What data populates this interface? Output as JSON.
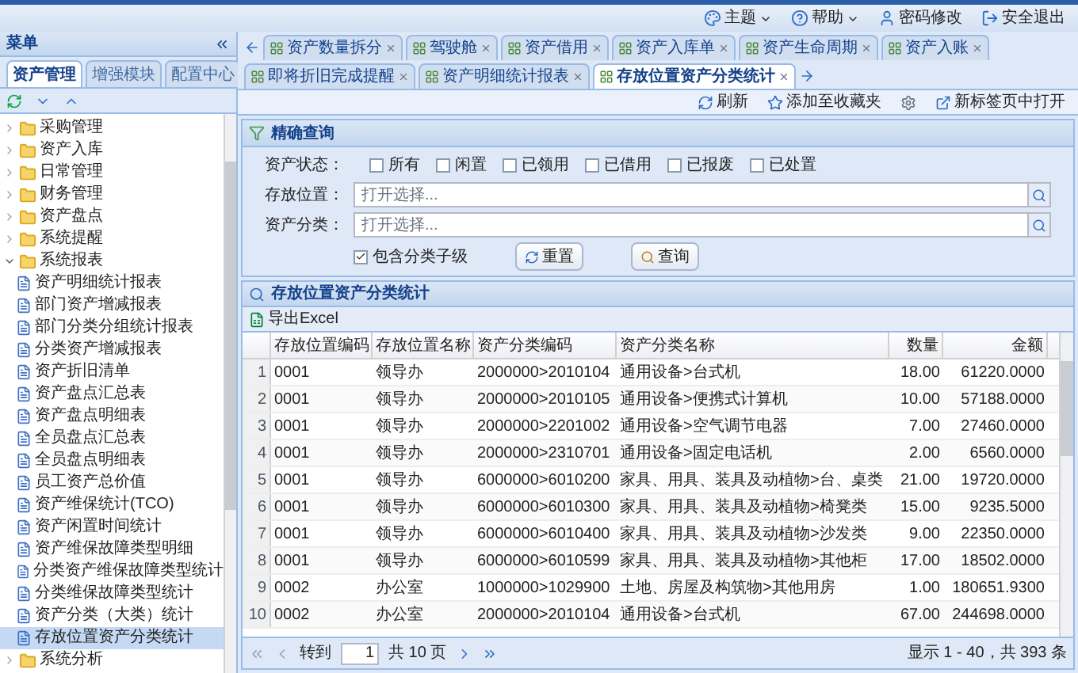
{
  "header": {
    "links": [
      {
        "label": "主题",
        "kind": "menu"
      },
      {
        "label": "帮助",
        "kind": "menu"
      },
      {
        "label": "密码修改",
        "kind": "link"
      },
      {
        "label": "安全退出",
        "kind": "link"
      }
    ]
  },
  "sidebar": {
    "title": "菜单",
    "tabs": [
      {
        "label": "资产管理",
        "selected": true
      },
      {
        "label": "增强模块",
        "selected": false
      },
      {
        "label": "配置中心",
        "selected": false
      }
    ],
    "tree": [
      {
        "label": "采购管理",
        "kind": "folder",
        "expanded": false,
        "selected": false
      },
      {
        "label": "资产入库",
        "kind": "folder",
        "expanded": false,
        "selected": false
      },
      {
        "label": "日常管理",
        "kind": "folder",
        "expanded": false,
        "selected": false
      },
      {
        "label": "财务管理",
        "kind": "folder",
        "expanded": false,
        "selected": false
      },
      {
        "label": "资产盘点",
        "kind": "folder",
        "expanded": false,
        "selected": false
      },
      {
        "label": "系统提醒",
        "kind": "folder",
        "expanded": false,
        "selected": false
      },
      {
        "label": "系统报表",
        "kind": "folder",
        "expanded": true,
        "selected": false,
        "children": [
          {
            "label": "资产明细统计报表",
            "kind": "report",
            "selected": false
          },
          {
            "label": "部门资产增减报表",
            "kind": "report",
            "selected": false
          },
          {
            "label": "部门分类分组统计报表",
            "kind": "report",
            "selected": false
          },
          {
            "label": "分类资产增减报表",
            "kind": "report",
            "selected": false
          },
          {
            "label": "资产折旧清单",
            "kind": "report",
            "selected": false
          },
          {
            "label": "资产盘点汇总表",
            "kind": "report",
            "selected": false
          },
          {
            "label": "资产盘点明细表",
            "kind": "report",
            "selected": false
          },
          {
            "label": "全员盘点汇总表",
            "kind": "report",
            "selected": false
          },
          {
            "label": "全员盘点明细表",
            "kind": "report",
            "selected": false
          },
          {
            "label": "员工资产总价值",
            "kind": "report",
            "selected": false
          },
          {
            "label": "资产维保统计(TCO)",
            "kind": "report",
            "selected": false
          },
          {
            "label": "资产闲置时间统计",
            "kind": "report",
            "selected": false
          },
          {
            "label": "资产维保故障类型明细",
            "kind": "report",
            "selected": false
          },
          {
            "label": "分类资产维保故障类型统计",
            "kind": "report",
            "selected": false
          },
          {
            "label": "分类维保故障类型统计",
            "kind": "report",
            "selected": false
          },
          {
            "label": "资产分类（大类）统计",
            "kind": "report",
            "selected": false
          },
          {
            "label": "存放位置资产分类统计",
            "kind": "report",
            "selected": true
          }
        ]
      },
      {
        "label": "系统分析",
        "kind": "folder",
        "expanded": false,
        "selected": false
      }
    ]
  },
  "tabs": [
    {
      "label": "资产数量拆分",
      "selected": false
    },
    {
      "label": "驾驶舱",
      "selected": false
    },
    {
      "label": "资产借用",
      "selected": false
    },
    {
      "label": "资产入库单",
      "selected": false
    },
    {
      "label": "资产生命周期",
      "selected": false
    },
    {
      "label": "资产入账",
      "selected": false
    },
    {
      "label": "即将折旧完成提醒",
      "selected": false
    },
    {
      "label": "资产明细统计报表",
      "selected": false
    },
    {
      "label": "存放位置资产分类统计",
      "selected": true
    }
  ],
  "toolbar": [
    "刷新",
    "添加至收藏夹",
    "新标签页中打开"
  ],
  "query": {
    "title": "精确查询",
    "status_label": "资产状态：",
    "status_options": [
      {
        "label": "所有",
        "checked": false
      },
      {
        "label": "闲置",
        "checked": false
      },
      {
        "label": "已领用",
        "checked": false
      },
      {
        "label": "已借用",
        "checked": false
      },
      {
        "label": "已报废",
        "checked": false
      },
      {
        "label": "已处置",
        "checked": false
      }
    ],
    "fields": [
      {
        "label": "存放位置：",
        "placeholder": "打开选择..."
      },
      {
        "label": "资产分类：",
        "placeholder": "打开选择..."
      }
    ],
    "include_children": {
      "label": "包含分类子级",
      "checked": true
    },
    "buttons": [
      "重置",
      "查询"
    ]
  },
  "grid": {
    "title": "存放位置资产分类统计",
    "export": "导出Excel",
    "columns": [
      "存放位置编码",
      "存放位置名称",
      "资产分类编码",
      "资产分类名称",
      "数量",
      "金额"
    ],
    "rows": [
      {
        "number": "1",
        "cells": [
          "0001",
          "领导办",
          "2000000>2010104",
          "通用设备>台式机",
          "18.00",
          "61220.0000"
        ]
      },
      {
        "number": "2",
        "cells": [
          "0001",
          "领导办",
          "2000000>2010105",
          "通用设备>便携式计算机",
          "10.00",
          "57188.0000"
        ]
      },
      {
        "number": "3",
        "cells": [
          "0001",
          "领导办",
          "2000000>2201002",
          "通用设备>空气调节电器",
          "7.00",
          "27460.0000"
        ]
      },
      {
        "number": "4",
        "cells": [
          "0001",
          "领导办",
          "2000000>2310701",
          "通用设备>固定电话机",
          "2.00",
          "6560.0000"
        ]
      },
      {
        "number": "5",
        "cells": [
          "0001",
          "领导办",
          "6000000>6010200",
          "家具、用具、装具及动植物>台、桌类",
          "21.00",
          "19720.0000"
        ]
      },
      {
        "number": "6",
        "cells": [
          "0001",
          "领导办",
          "6000000>6010300",
          "家具、用具、装具及动植物>椅凳类",
          "15.00",
          "9235.5000"
        ]
      },
      {
        "number": "7",
        "cells": [
          "0001",
          "领导办",
          "6000000>6010400",
          "家具、用具、装具及动植物>沙发类",
          "9.00",
          "22350.0000"
        ]
      },
      {
        "number": "8",
        "cells": [
          "0001",
          "领导办",
          "6000000>6010599",
          "家具、用具、装具及动植物>其他柜",
          "17.00",
          "18502.0000"
        ]
      },
      {
        "number": "9",
        "cells": [
          "0002",
          "办公室",
          "1000000>1029900",
          "土地、房屋及构筑物>其他用房",
          "1.00",
          "180651.9300"
        ]
      },
      {
        "number": "10",
        "cells": [
          "0002",
          "办公室",
          "2000000>2010104",
          "通用设备>台式机",
          "67.00",
          "244698.0000"
        ]
      }
    ],
    "pager": {
      "goto": "转到",
      "page": "1",
      "total": "共 10 页",
      "summary": "显示 1 - 40，共 393 条"
    }
  }
}
